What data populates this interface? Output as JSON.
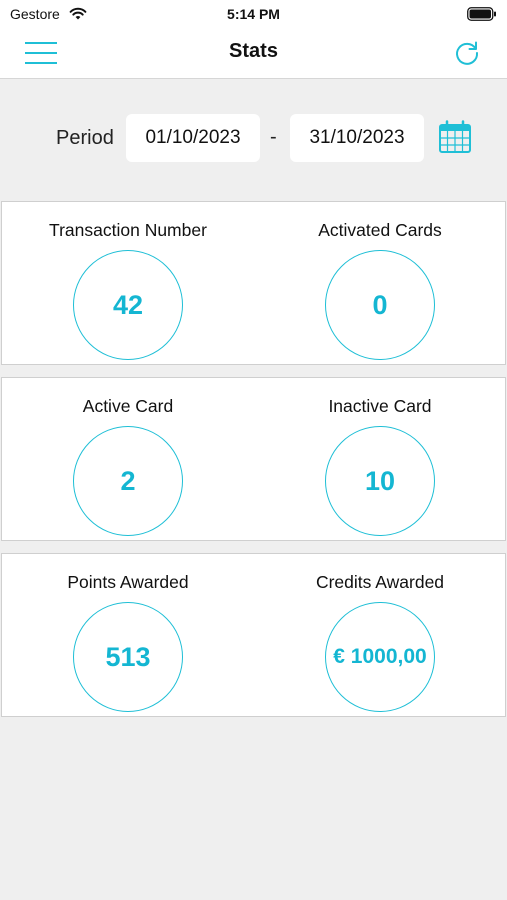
{
  "status_bar": {
    "carrier": "Gestore",
    "time": "5:14 PM"
  },
  "nav": {
    "title": "Stats",
    "menu_icon": "hamburger-menu-icon",
    "refresh_icon": "refresh-icon"
  },
  "period": {
    "label": "Period",
    "from": "01/10/2023",
    "separator": "-",
    "to": "31/10/2023",
    "calendar_icon": "calendar-icon"
  },
  "stats": [
    {
      "label": "Transaction Number",
      "value": "42"
    },
    {
      "label": "Activated Cards",
      "value": "0"
    },
    {
      "label": "Active Card",
      "value": "2"
    },
    {
      "label": "Inactive Card",
      "value": "10"
    },
    {
      "label": "Points Awarded",
      "value": "513"
    },
    {
      "label": "Credits Awarded",
      "value": "€ 1000,00"
    }
  ],
  "colors": {
    "accent": "#14b6d2",
    "background": "#efefef",
    "card": "#ffffff"
  }
}
